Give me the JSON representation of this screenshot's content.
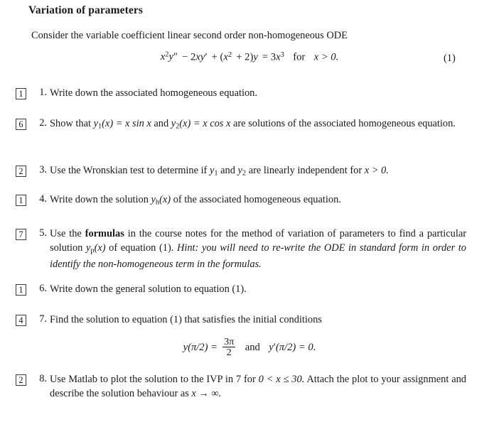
{
  "document": {
    "title": "Variation of parameters",
    "intro": "Consider the variable coefficient linear second order non-homogeneous ODE",
    "equation": {
      "label": "(1)",
      "lhs_1": "x",
      "lhs_1_sup": "2",
      "lhs_2": "y",
      "lhs_2_prime": "″",
      "op_1": "− 2",
      "lhs_3": "xy",
      "lhs_3_prime": "′",
      "op_2": "+ (",
      "lhs_4": "x",
      "lhs_4_sup": "2",
      "op_3": "+ 2)",
      "lhs_5": "y",
      "eq": "= 3",
      "rhs": "x",
      "rhs_sup": "3",
      "condition_for": "for",
      "condition": "x > 0.",
      "plain": "x²y″ − 2xy′ + (x² + 2)y = 3x³  for  x > 0."
    },
    "problems": [
      {
        "marks": "1",
        "number": "1.",
        "text": "Write down the associated homogeneous equation."
      },
      {
        "marks": "6",
        "number": "2.",
        "text_a": "Show that ",
        "math_y1": "y",
        "math_y1_sub": "1",
        "math_y1_arg": "(x) = x sin x",
        "text_b": " and ",
        "math_y2": "y",
        "math_y2_sub": "2",
        "math_y2_arg": "(x) = x cos x",
        "text_c": " are solutions of the associated homogeneous equation.",
        "plain": "Show that y1(x) = x sin x and y2(x) = x cos x are solutions of the associated homogeneous equation."
      },
      {
        "marks": "2",
        "number": "3.",
        "text_a": "Use the Wronskian test to determine if ",
        "math_y1": "y",
        "math_y1_sub": "1",
        "text_b": " and ",
        "math_y2": "y",
        "math_y2_sub": "2",
        "text_c": " are linearly independent for ",
        "math_cond": "x > 0.",
        "plain": "Use the Wronskian test to determine if y1 and y2 are linearly independent for x > 0."
      },
      {
        "marks": "1",
        "number": "4.",
        "text_a": "Write down the solution ",
        "math_yh": "y",
        "math_yh_sub": "h",
        "math_yh_arg": "(x)",
        "text_b": " of the associated homogeneous equation.",
        "plain": "Write down the solution yh(x) of the associated homogeneous equation."
      },
      {
        "marks": "7",
        "number": "5.",
        "text_a": "Use the ",
        "bold": "formulas",
        "text_b": " in the course notes for the method of variation of parameters to find a particular solution ",
        "math_yp": "y",
        "math_yp_sub": "p",
        "math_yp_arg": "(x)",
        "text_c": " of equation (1).",
        "hint_label": "Hint:",
        "hint_text": " you will need to re-write the ODE in standard form in order to identify the non-homogeneous term in the formulas.",
        "plain": "Use the formulas in the course notes for the method of variation of parameters to find a particular solution yp(x) of equation (1). Hint: you will need to re-write the ODE in standard form in order to identify the non-homogeneous term in the formulas."
      },
      {
        "marks": "1",
        "number": "6.",
        "text": "Write down the general solution to equation (1)."
      },
      {
        "marks": "4",
        "number": "7.",
        "text": "Find the solution to equation (1) that satisfies the initial conditions",
        "initial_conditions": {
          "lhs": "y(π/2) =",
          "frac_num": "3π",
          "frac_den": "2",
          "conj": "and",
          "rhs_y": "y",
          "rhs_prime": "′",
          "rhs_rest": "(π/2) = 0.",
          "plain": "y(π/2) = 3π/2  and  y′(π/2) = 0."
        }
      },
      {
        "marks": "2",
        "number": "8.",
        "text_a": "Use Matlab to plot the solution to the IVP in 7 for ",
        "math_range": "0 < x ≤ 30.",
        "text_b": " Attach the plot to your assignment and describe the solution behaviour as ",
        "math_limit": "x → ∞.",
        "plain": "Use Matlab to plot the solution to the IVP in 7 for 0 < x ≤ 30. Attach the plot to your assignment and describe the solution behaviour as x → ∞."
      }
    ]
  }
}
